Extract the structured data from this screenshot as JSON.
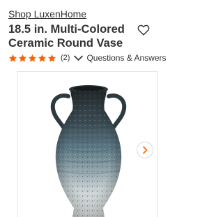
{
  "product": {
    "brand": "Shop LuxenHome",
    "title_line1": "18.5 in. Multi-Colored",
    "title_line2": "Ceramic Round Vase",
    "rating": 5,
    "rating_max": 5,
    "review_count": "(2)",
    "qa_label": "Questions & Answers"
  },
  "icons": {
    "favorite": "heart-outline-icon",
    "star": "star-icon",
    "expand": "chevron-down-icon",
    "next": "chevron-right-icon"
  },
  "colors": {
    "star": "#f96302",
    "next_arrow": "#f96302",
    "text": "#333333"
  }
}
